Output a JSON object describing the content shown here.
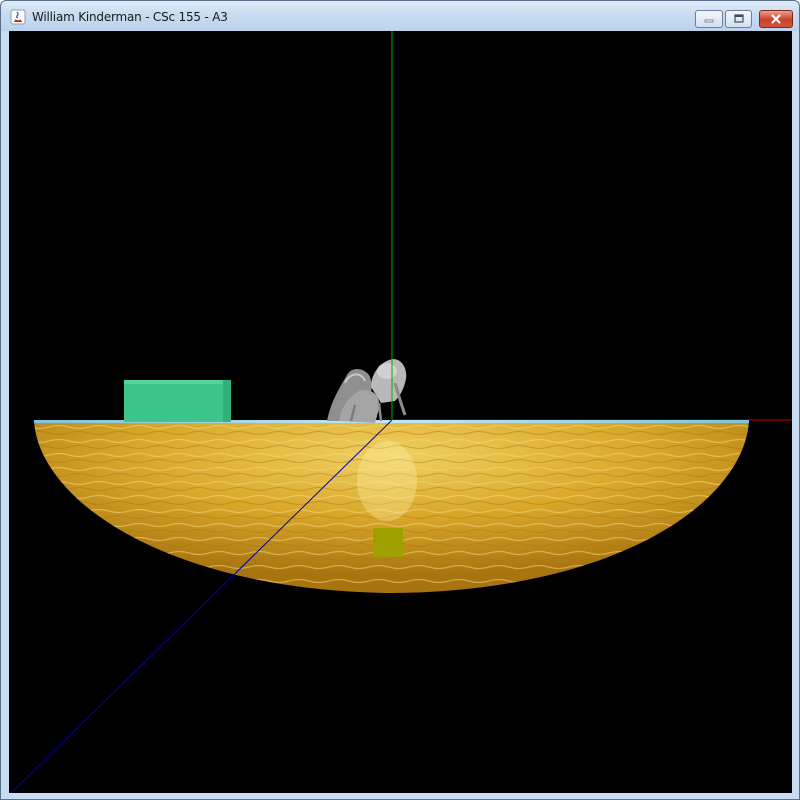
{
  "window": {
    "title": "William Kinderman - CSc 155 - A3",
    "app_icon": "java-icon",
    "controls": {
      "minimize_icon": "minimize-icon",
      "maximize_icon": "maximize-icon",
      "close_icon": "close-icon"
    }
  },
  "scene": {
    "background_color": "#000000",
    "axes": {
      "x_color": "#c00000",
      "y_color": "#00b000",
      "z_color": "#0000aa"
    },
    "objects": {
      "ground_dish_color": "#d4a020",
      "water_surface_color": "#8fd0e8",
      "green_cube_color": "#3cc48a",
      "yellow_cube_color": "#a0a000",
      "creature_color": "#9a9a9a"
    }
  }
}
